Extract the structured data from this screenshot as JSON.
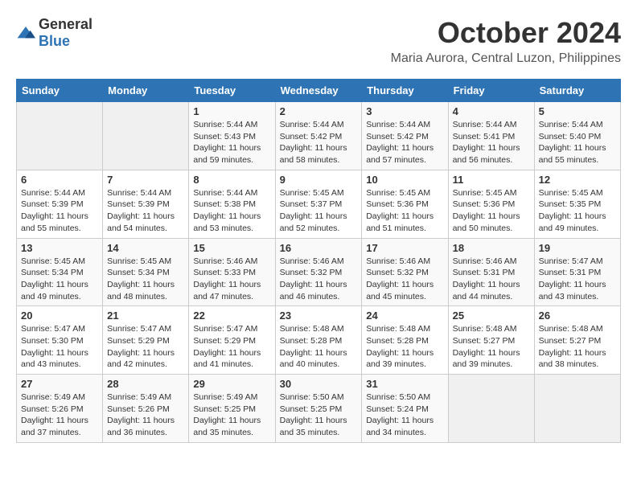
{
  "header": {
    "logo_general": "General",
    "logo_blue": "Blue",
    "month": "October 2024",
    "location": "Maria Aurora, Central Luzon, Philippines"
  },
  "weekdays": [
    "Sunday",
    "Monday",
    "Tuesday",
    "Wednesday",
    "Thursday",
    "Friday",
    "Saturday"
  ],
  "weeks": [
    [
      {
        "day": "",
        "sunrise": "",
        "sunset": "",
        "daylight": ""
      },
      {
        "day": "",
        "sunrise": "",
        "sunset": "",
        "daylight": ""
      },
      {
        "day": "1",
        "sunrise": "Sunrise: 5:44 AM",
        "sunset": "Sunset: 5:43 PM",
        "daylight": "Daylight: 11 hours and 59 minutes."
      },
      {
        "day": "2",
        "sunrise": "Sunrise: 5:44 AM",
        "sunset": "Sunset: 5:42 PM",
        "daylight": "Daylight: 11 hours and 58 minutes."
      },
      {
        "day": "3",
        "sunrise": "Sunrise: 5:44 AM",
        "sunset": "Sunset: 5:42 PM",
        "daylight": "Daylight: 11 hours and 57 minutes."
      },
      {
        "day": "4",
        "sunrise": "Sunrise: 5:44 AM",
        "sunset": "Sunset: 5:41 PM",
        "daylight": "Daylight: 11 hours and 56 minutes."
      },
      {
        "day": "5",
        "sunrise": "Sunrise: 5:44 AM",
        "sunset": "Sunset: 5:40 PM",
        "daylight": "Daylight: 11 hours and 55 minutes."
      }
    ],
    [
      {
        "day": "6",
        "sunrise": "Sunrise: 5:44 AM",
        "sunset": "Sunset: 5:39 PM",
        "daylight": "Daylight: 11 hours and 55 minutes."
      },
      {
        "day": "7",
        "sunrise": "Sunrise: 5:44 AM",
        "sunset": "Sunset: 5:39 PM",
        "daylight": "Daylight: 11 hours and 54 minutes."
      },
      {
        "day": "8",
        "sunrise": "Sunrise: 5:44 AM",
        "sunset": "Sunset: 5:38 PM",
        "daylight": "Daylight: 11 hours and 53 minutes."
      },
      {
        "day": "9",
        "sunrise": "Sunrise: 5:45 AM",
        "sunset": "Sunset: 5:37 PM",
        "daylight": "Daylight: 11 hours and 52 minutes."
      },
      {
        "day": "10",
        "sunrise": "Sunrise: 5:45 AM",
        "sunset": "Sunset: 5:36 PM",
        "daylight": "Daylight: 11 hours and 51 minutes."
      },
      {
        "day": "11",
        "sunrise": "Sunrise: 5:45 AM",
        "sunset": "Sunset: 5:36 PM",
        "daylight": "Daylight: 11 hours and 50 minutes."
      },
      {
        "day": "12",
        "sunrise": "Sunrise: 5:45 AM",
        "sunset": "Sunset: 5:35 PM",
        "daylight": "Daylight: 11 hours and 49 minutes."
      }
    ],
    [
      {
        "day": "13",
        "sunrise": "Sunrise: 5:45 AM",
        "sunset": "Sunset: 5:34 PM",
        "daylight": "Daylight: 11 hours and 49 minutes."
      },
      {
        "day": "14",
        "sunrise": "Sunrise: 5:45 AM",
        "sunset": "Sunset: 5:34 PM",
        "daylight": "Daylight: 11 hours and 48 minutes."
      },
      {
        "day": "15",
        "sunrise": "Sunrise: 5:46 AM",
        "sunset": "Sunset: 5:33 PM",
        "daylight": "Daylight: 11 hours and 47 minutes."
      },
      {
        "day": "16",
        "sunrise": "Sunrise: 5:46 AM",
        "sunset": "Sunset: 5:32 PM",
        "daylight": "Daylight: 11 hours and 46 minutes."
      },
      {
        "day": "17",
        "sunrise": "Sunrise: 5:46 AM",
        "sunset": "Sunset: 5:32 PM",
        "daylight": "Daylight: 11 hours and 45 minutes."
      },
      {
        "day": "18",
        "sunrise": "Sunrise: 5:46 AM",
        "sunset": "Sunset: 5:31 PM",
        "daylight": "Daylight: 11 hours and 44 minutes."
      },
      {
        "day": "19",
        "sunrise": "Sunrise: 5:47 AM",
        "sunset": "Sunset: 5:31 PM",
        "daylight": "Daylight: 11 hours and 43 minutes."
      }
    ],
    [
      {
        "day": "20",
        "sunrise": "Sunrise: 5:47 AM",
        "sunset": "Sunset: 5:30 PM",
        "daylight": "Daylight: 11 hours and 43 minutes."
      },
      {
        "day": "21",
        "sunrise": "Sunrise: 5:47 AM",
        "sunset": "Sunset: 5:29 PM",
        "daylight": "Daylight: 11 hours and 42 minutes."
      },
      {
        "day": "22",
        "sunrise": "Sunrise: 5:47 AM",
        "sunset": "Sunset: 5:29 PM",
        "daylight": "Daylight: 11 hours and 41 minutes."
      },
      {
        "day": "23",
        "sunrise": "Sunrise: 5:48 AM",
        "sunset": "Sunset: 5:28 PM",
        "daylight": "Daylight: 11 hours and 40 minutes."
      },
      {
        "day": "24",
        "sunrise": "Sunrise: 5:48 AM",
        "sunset": "Sunset: 5:28 PM",
        "daylight": "Daylight: 11 hours and 39 minutes."
      },
      {
        "day": "25",
        "sunrise": "Sunrise: 5:48 AM",
        "sunset": "Sunset: 5:27 PM",
        "daylight": "Daylight: 11 hours and 39 minutes."
      },
      {
        "day": "26",
        "sunrise": "Sunrise: 5:48 AM",
        "sunset": "Sunset: 5:27 PM",
        "daylight": "Daylight: 11 hours and 38 minutes."
      }
    ],
    [
      {
        "day": "27",
        "sunrise": "Sunrise: 5:49 AM",
        "sunset": "Sunset: 5:26 PM",
        "daylight": "Daylight: 11 hours and 37 minutes."
      },
      {
        "day": "28",
        "sunrise": "Sunrise: 5:49 AM",
        "sunset": "Sunset: 5:26 PM",
        "daylight": "Daylight: 11 hours and 36 minutes."
      },
      {
        "day": "29",
        "sunrise": "Sunrise: 5:49 AM",
        "sunset": "Sunset: 5:25 PM",
        "daylight": "Daylight: 11 hours and 35 minutes."
      },
      {
        "day": "30",
        "sunrise": "Sunrise: 5:50 AM",
        "sunset": "Sunset: 5:25 PM",
        "daylight": "Daylight: 11 hours and 35 minutes."
      },
      {
        "day": "31",
        "sunrise": "Sunrise: 5:50 AM",
        "sunset": "Sunset: 5:24 PM",
        "daylight": "Daylight: 11 hours and 34 minutes."
      },
      {
        "day": "",
        "sunrise": "",
        "sunset": "",
        "daylight": ""
      },
      {
        "day": "",
        "sunrise": "",
        "sunset": "",
        "daylight": ""
      }
    ]
  ]
}
